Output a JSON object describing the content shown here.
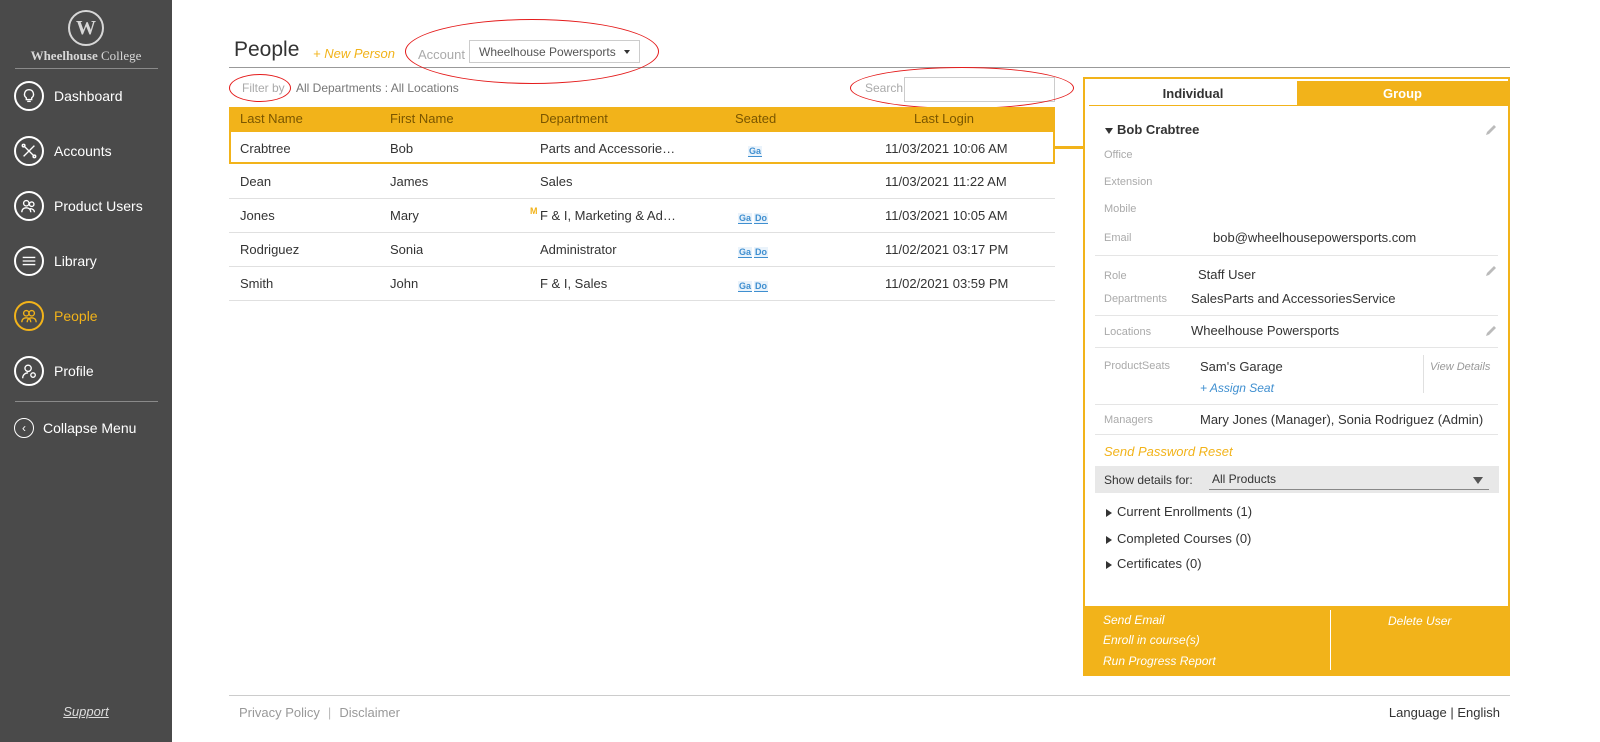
{
  "sidebar": {
    "logo_initial": "W",
    "logo_text_bold": "Wheelhouse",
    "logo_text": " College",
    "items": [
      {
        "label": "Dashboard",
        "icon": "lightbulb-icon",
        "active": false
      },
      {
        "label": "Accounts",
        "icon": "tools-icon",
        "active": false
      },
      {
        "label": "Product Users",
        "icon": "users-icon",
        "active": false
      },
      {
        "label": "Library",
        "icon": "library-icon",
        "active": false
      },
      {
        "label": "People",
        "icon": "people-icon",
        "active": true
      },
      {
        "label": "Profile",
        "icon": "profile-icon",
        "active": false
      }
    ],
    "collapse_label": "Collapse Menu",
    "support_label": "Support"
  },
  "header": {
    "title": "People",
    "new_person": "+ New Person",
    "account_label": "Account",
    "account_value": "Wheelhouse Powersports",
    "filter_label": "Filter by",
    "filter_value": "All Departments : All Locations",
    "search_label": "Search",
    "search_value": ""
  },
  "table": {
    "columns": [
      "Last Name",
      "First Name",
      "Department",
      "Seated",
      "Last Login"
    ],
    "rows": [
      {
        "last": "Crabtree",
        "first": "Bob",
        "dept": "Parts and Accessorie…",
        "manager": "",
        "seats": [
          "Ga"
        ],
        "login": "11/03/2021 10:06 AM"
      },
      {
        "last": "Dean",
        "first": "James",
        "dept": "Sales",
        "manager": "",
        "seats": [],
        "login": "11/03/2021 11:22 AM"
      },
      {
        "last": "Jones",
        "first": "Mary",
        "dept": "F & I, Marketing & Ad…",
        "manager": "M",
        "seats": [
          "Ga",
          "Do"
        ],
        "login": "11/03/2021 10:05 AM"
      },
      {
        "last": "Rodriguez",
        "first": "Sonia",
        "dept": "Administrator",
        "manager": "",
        "seats": [
          "Ga",
          "Do"
        ],
        "login": "11/02/2021 03:17 PM"
      },
      {
        "last": "Smith",
        "first": "John",
        "dept": "F & I, Sales",
        "manager": "",
        "seats": [
          "Ga",
          "Do"
        ],
        "login": "11/02/2021 03:59 PM"
      }
    ]
  },
  "detail": {
    "tab_individual": "Individual",
    "tab_group": "Group",
    "name": "Bob Crabtree",
    "office_label": "Office",
    "extension_label": "Extension",
    "mobile_label": "Mobile",
    "email_label": "Email",
    "email_value": "bob@wheelhousepowersports.com",
    "role_label": "Role",
    "role_value": "Staff User",
    "departments_label": "Departments",
    "departments_value": "SalesParts and AccessoriesService",
    "locations_label": "Locations",
    "locations_value": "Wheelhouse Powersports",
    "seats_label": "ProductSeats",
    "seats_value": "Sam's Garage",
    "assign_seat": "+ Assign Seat",
    "view_details": "View Details",
    "managers_label": "Managers",
    "managers_value": "Mary Jones (Manager), Sonia Rodriguez (Admin)",
    "send_reset": "Send Password Reset",
    "show_details_label": "Show details for:",
    "show_details_value": "All Products",
    "current_enrollments": "Current Enrollments (1)",
    "completed_courses": "Completed Courses (0)",
    "certificates": "Certificates (0)",
    "send_email": "Send Email",
    "enroll": "Enroll in course(s)",
    "run_report": "Run Progress Report",
    "delete_user": "Delete User"
  },
  "footer": {
    "privacy": "Privacy Policy",
    "separator": "|",
    "disclaimer": "Disclaimer",
    "language_label": "Language",
    "language_sep": " | ",
    "language_value": "English"
  },
  "colors": {
    "accent": "#f2b31a",
    "sidebar_bg": "#4a4a4a",
    "annotation": "#e41b1b",
    "seat_badge": "#3f8fd0"
  }
}
